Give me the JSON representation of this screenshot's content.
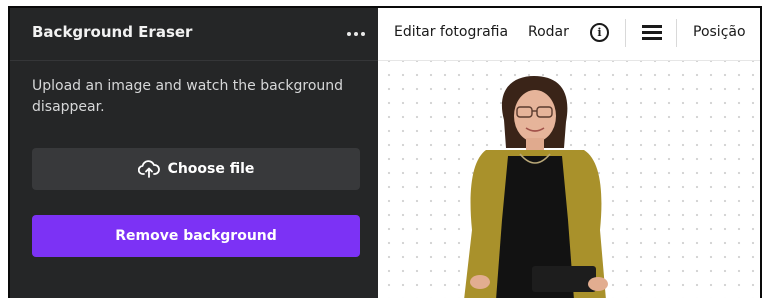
{
  "panel": {
    "title": "Background Eraser",
    "more_icon": "more-horizontal-icon",
    "description": "Upload an image and watch the background disappear.",
    "choose_file_label": "Choose file",
    "choose_file_icon": "cloud-upload-icon",
    "remove_background_label": "Remove background"
  },
  "toolbar": {
    "edit_photo_label": "Editar fotografia",
    "rotate_label": "Rodar",
    "info_icon": "info-icon",
    "menu_icon": "menu-lines-icon",
    "position_label": "Posição"
  },
  "colors": {
    "panel_bg": "#252627",
    "button_secondary": "#38393b",
    "accent_purple": "#7c32f5",
    "canvas_bg": "#ffffff"
  }
}
